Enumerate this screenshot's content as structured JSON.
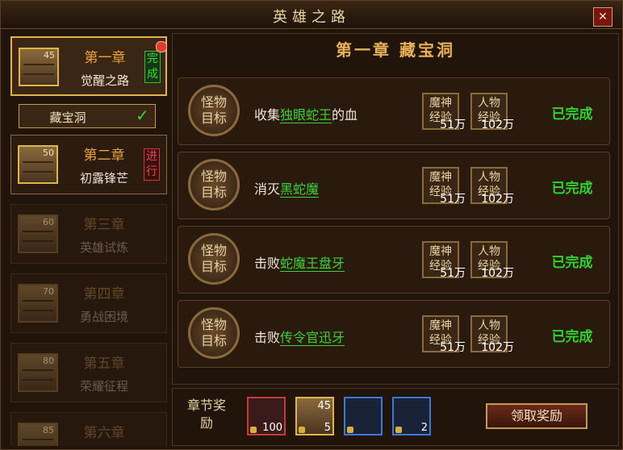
{
  "window": {
    "title": "英雄之路",
    "close": "✕"
  },
  "chapters": [
    {
      "level": "45",
      "title": "第一章",
      "subtitle": "觉醒之路",
      "status": "完成",
      "state": "done",
      "active": true
    },
    {
      "level": "50",
      "title": "第二章",
      "subtitle": "初露锋芒",
      "status": "进行",
      "state": "progress",
      "active": false
    },
    {
      "level": "60",
      "title": "第三章",
      "subtitle": "英雄试炼",
      "state": "locked"
    },
    {
      "level": "70",
      "title": "第四章",
      "subtitle": "勇战困境",
      "state": "locked"
    },
    {
      "level": "80",
      "title": "第五章",
      "subtitle": "荣耀征程",
      "state": "locked"
    },
    {
      "level": "85",
      "title": "第六章",
      "subtitle": "",
      "state": "locked"
    }
  ],
  "subchapter": {
    "label": "藏宝洞",
    "check": "✓"
  },
  "header": "第一章 藏宝洞",
  "medal_label": "怪物目标",
  "reward_labels": {
    "magic": "魔神经验",
    "exp": "人物经验"
  },
  "tasks": [
    {
      "prefix": "收集",
      "target": "独眼蛇王",
      "suffix": "的血",
      "magic": "51万",
      "exp": "102万",
      "status": "已完成"
    },
    {
      "prefix": "消灭",
      "target": "黑蛇魔",
      "suffix": "",
      "magic": "51万",
      "exp": "102万",
      "status": "已完成"
    },
    {
      "prefix": "击败",
      "target": "蛇魔王盘牙",
      "suffix": "",
      "magic": "51万",
      "exp": "102万",
      "status": "已完成"
    },
    {
      "prefix": "击败",
      "target": "传令官迅牙",
      "suffix": "",
      "magic": "51万",
      "exp": "102万",
      "status": "已完成"
    }
  ],
  "chapter_reward": {
    "label": "章节奖励",
    "items": [
      {
        "icon": "silver-ingot-icon",
        "count": "100",
        "color": "#c83a3a"
      },
      {
        "icon": "chest-icon",
        "count": "5",
        "level": "45",
        "color": "#e0b547"
      },
      {
        "icon": "gold-bar-icon",
        "count": "",
        "color": "#3a7ad8"
      },
      {
        "icon": "red-gem-icon",
        "count": "2",
        "color": "#3a7ad8"
      }
    ],
    "claim": "领取奖励"
  }
}
